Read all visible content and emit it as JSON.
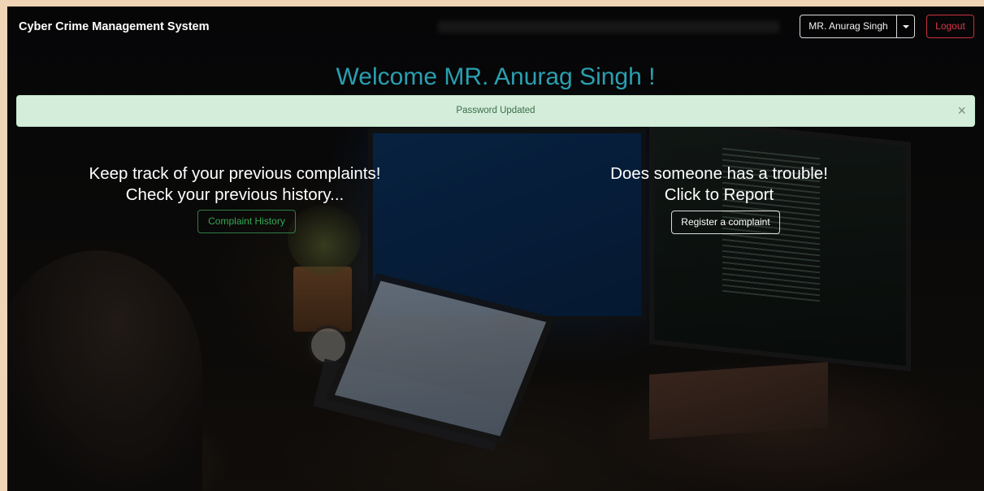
{
  "navbar": {
    "brand": "Cyber Crime Management System",
    "user_name": "MR. Anurag Singh",
    "logout_label": "Logout"
  },
  "welcome": "Welcome MR. Anurag Singh !",
  "alert": {
    "message": "Password Updated",
    "close_glyph": "×"
  },
  "left_panel": {
    "line1": "Keep track of your previous complaints!",
    "line2": "Check your previous history...",
    "button_label": "Complaint History"
  },
  "right_panel": {
    "line1": "Does someone has a trouble!",
    "line2": "Click to Report",
    "button_label": "Register a complaint"
  },
  "colors": {
    "welcome": "#2a9fb0",
    "alert_bg": "#d4edda",
    "logout": "#dc3545",
    "history_button": "#34a852"
  },
  "icons": {
    "user_dropdown": "chevron-down-icon",
    "alert_close": "close-icon"
  }
}
